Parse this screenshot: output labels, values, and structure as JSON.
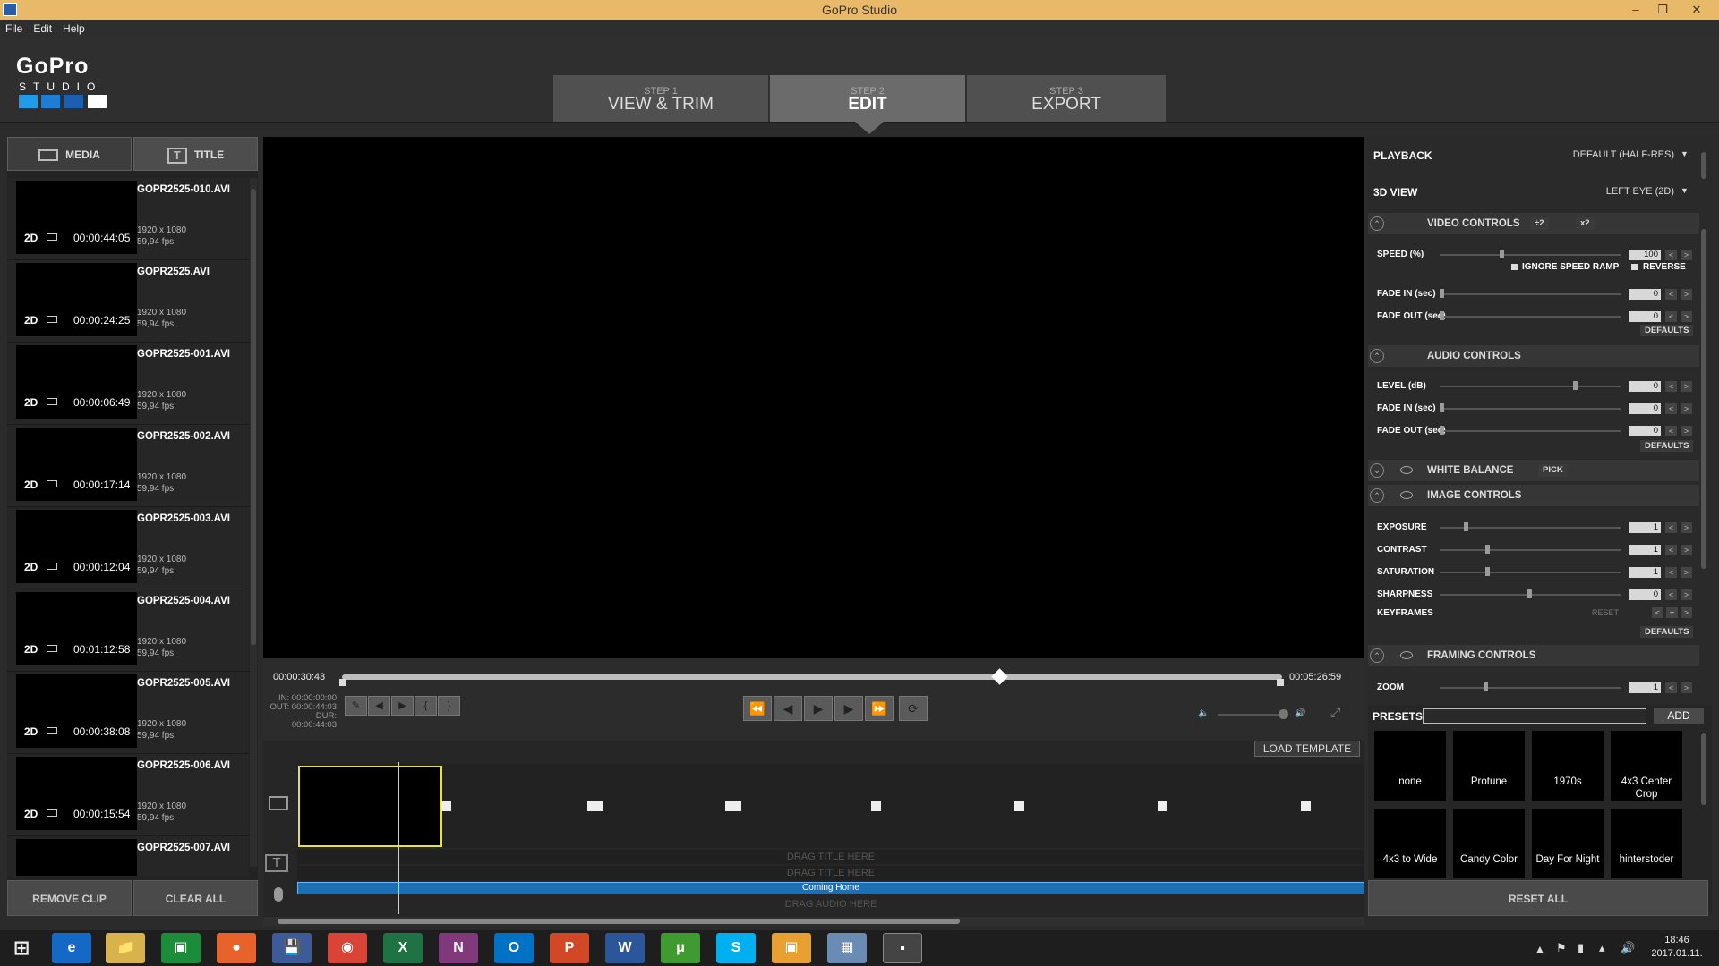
{
  "window": {
    "title": "GoPro Studio"
  },
  "menu": [
    "File",
    "Edit",
    "Help"
  ],
  "logo": {
    "top": "GoPro",
    "sub": "STUDIO"
  },
  "steps": [
    {
      "small": "STEP 1",
      "big": "VIEW & TRIM"
    },
    {
      "small": "STEP 2",
      "big": "EDIT"
    },
    {
      "small": "STEP 3",
      "big": "EXPORT"
    }
  ],
  "media_tabs": {
    "media": "MEDIA",
    "title": "TITLE"
  },
  "clips": [
    {
      "name": "GOPR2525-010.AVI",
      "dim": "2D",
      "duration": "00:00:44:05",
      "res": "1920 x 1080",
      "fps": "59,94 fps"
    },
    {
      "name": "GOPR2525.AVI",
      "dim": "2D",
      "duration": "00:00:24:25",
      "res": "1920 x 1080",
      "fps": "59,94 fps"
    },
    {
      "name": "GOPR2525-001.AVI",
      "dim": "2D",
      "duration": "00:00:06:49",
      "res": "1920 x 1080",
      "fps": "59,94 fps"
    },
    {
      "name": "GOPR2525-002.AVI",
      "dim": "2D",
      "duration": "00:00:17:14",
      "res": "1920 x 1080",
      "fps": "59,94 fps"
    },
    {
      "name": "GOPR2525-003.AVI",
      "dim": "2D",
      "duration": "00:00:12:04",
      "res": "1920 x 1080",
      "fps": "59,94 fps"
    },
    {
      "name": "GOPR2525-004.AVI",
      "dim": "2D",
      "duration": "00:01:12:58",
      "res": "1920 x 1080",
      "fps": "59,94 fps"
    },
    {
      "name": "GOPR2525-005.AVI",
      "dim": "2D",
      "duration": "00:00:38:08",
      "res": "1920 x 1080",
      "fps": "59,94 fps"
    },
    {
      "name": "GOPR2525-006.AVI",
      "dim": "2D",
      "duration": "00:00:15:54",
      "res": "1920 x 1080",
      "fps": "59,94 fps"
    },
    {
      "name": "GOPR2525-007.AVI",
      "dim": "",
      "duration": "",
      "res": "",
      "fps": ""
    }
  ],
  "media_buttons": {
    "remove": "REMOVE CLIP",
    "clear": "CLEAR ALL"
  },
  "transport": {
    "current": "00:00:30:43",
    "total": "00:05:26:59",
    "in": "IN: 00:00:00:00",
    "out": "OUT: 00:00:44:03",
    "dur": "DUR: 00:00:44:03",
    "playhead_fraction": 0.7
  },
  "timeline": {
    "load_template": "LOAD TEMPLATE",
    "drag_title_1": "DRAG TITLE HERE",
    "drag_title_2": "DRAG TITLE HERE",
    "audio_clip": "Coming Home",
    "drag_audio": "DRAG AUDIO HERE"
  },
  "right": {
    "playback_label": "PLAYBACK",
    "playback_value": "DEFAULT (HALF-RES)",
    "view3d_label": "3D VIEW",
    "view3d_value": "LEFT EYE (2D)",
    "video_controls": "VIDEO CONTROLS",
    "div2": "÷2",
    "x2": "x2",
    "speed": {
      "label": "SPEED (%)",
      "value": "100",
      "level": 0.34
    },
    "ignore_speed_ramp": "IGNORE SPEED RAMP",
    "reverse": "REVERSE",
    "v_fade_in": {
      "label": "FADE IN (sec)",
      "value": "0",
      "level": 0.0
    },
    "v_fade_out": {
      "label": "FADE OUT (sec)",
      "value": "0",
      "level": 0.0
    },
    "defaults": "DEFAULTS",
    "audio_controls": "AUDIO CONTROLS",
    "level": {
      "label": "LEVEL (dB)",
      "value": "0",
      "level": 0.76
    },
    "a_fade_in": {
      "label": "FADE IN (sec)",
      "value": "0",
      "level": 0.0
    },
    "a_fade_out": {
      "label": "FADE OUT (sec)",
      "value": "0",
      "level": 0.0
    },
    "white_balance": "WHITE BALANCE",
    "pick": "PICK",
    "image_controls": "IMAGE CONTROLS",
    "exposure": {
      "label": "EXPOSURE",
      "value": "1",
      "level": 0.14
    },
    "contrast": {
      "label": "CONTRAST",
      "value": "1",
      "level": 0.26
    },
    "saturation": {
      "label": "SATURATION",
      "value": "1",
      "level": 0.26
    },
    "sharpness": {
      "label": "SHARPNESS",
      "value": "0",
      "level": 0.5
    },
    "keyframes": "KEYFRAMES",
    "reset": "RESET",
    "framing_controls": "FRAMING CONTROLS",
    "zoom": {
      "label": "ZOOM",
      "value": "1",
      "level": 0.25
    },
    "presets_label": "PRESETS",
    "add": "ADD",
    "presets": [
      "none",
      "Protune",
      "1970s",
      "4x3 Center Crop",
      "4x3 to Wide",
      "Candy Color",
      "Day For Night",
      "hinterstoder"
    ],
    "reset_all": "RESET ALL"
  },
  "taskbar": {
    "time": "18:46",
    "date": "2017.01.11."
  },
  "colors": {
    "titlebar": "#e9b96a",
    "accent_blue": "#1e7ed6",
    "audio_clip": "#1a6fb5",
    "selection": "#e8e23a"
  }
}
